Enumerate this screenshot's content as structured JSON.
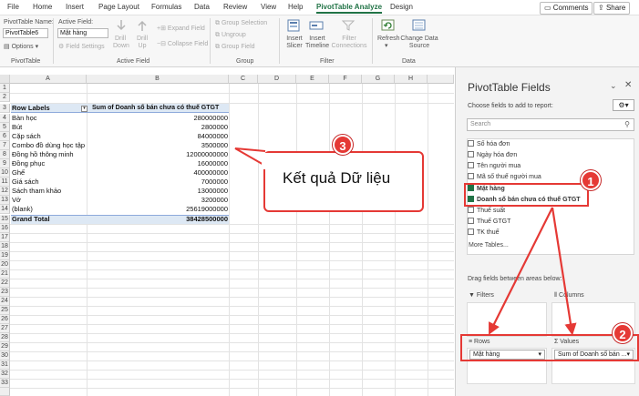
{
  "menu": {
    "items": [
      "File",
      "Home",
      "Insert",
      "Page Layout",
      "Formulas",
      "Data",
      "Review",
      "View",
      "Help",
      "PivotTable Analyze",
      "Design"
    ],
    "comments": "Comments",
    "share": "Share"
  },
  "ribbon": {
    "pt_name_label": "PivotTable Name:",
    "pt_name_value": "PivotTable6",
    "options": "Options",
    "active_field_label": "Active Field:",
    "active_field_value": "Mặt hàng",
    "field_settings": "Field Settings",
    "drill_down": "Drill Down",
    "drill_up": "Drill Up",
    "expand_field": "Expand Field",
    "collapse_field": "Collapse Field",
    "group_selection": "Group Selection",
    "ungroup": "Ungroup",
    "group_field": "Group Field",
    "insert_slicer": "Insert Slicer",
    "insert_timeline": "Insert Timeline",
    "filter_connections": "Filter Connections",
    "refresh": "Refresh",
    "change_data_source": "Change Data Source",
    "groups": [
      "PivotTable",
      "Active Field",
      "Group",
      "Filter",
      "Data"
    ]
  },
  "grid": {
    "columns": [
      "A",
      "B",
      "C",
      "D",
      "E",
      "F",
      "G",
      "H"
    ],
    "header_row": {
      "num": "3",
      "label": "Row Labels",
      "value_label": "Sum of Doanh số bán chưa có thuế GTGT"
    },
    "rows": [
      {
        "num": "4",
        "label": "Bàn học",
        "value": "280000000"
      },
      {
        "num": "5",
        "label": "Bút",
        "value": "2800000"
      },
      {
        "num": "6",
        "label": "Cặp sách",
        "value": "84000000"
      },
      {
        "num": "7",
        "label": "Combo đồ dùng học tập",
        "value": "3500000"
      },
      {
        "num": "8",
        "label": "Đồng hồ thông minh",
        "value": "12000000000"
      },
      {
        "num": "9",
        "label": "Đồng phục",
        "value": "16000000"
      },
      {
        "num": "10",
        "label": "Ghế",
        "value": "400000000"
      },
      {
        "num": "11",
        "label": "Giá sách",
        "value": "7000000"
      },
      {
        "num": "12",
        "label": "Sách tham khảo",
        "value": "13000000"
      },
      {
        "num": "13",
        "label": "Vở",
        "value": "3200000"
      },
      {
        "num": "14",
        "label": "(blank)",
        "value": "25619000000"
      }
    ],
    "total_row": {
      "num": "15",
      "label": "Grand Total",
      "value": "38428500000"
    },
    "empty_rows": [
      "1",
      "2",
      "16",
      "17",
      "18",
      "19",
      "20",
      "21",
      "22",
      "23",
      "24",
      "25",
      "26",
      "27",
      "28",
      "29",
      "30",
      "31",
      "32",
      "33"
    ]
  },
  "callout": {
    "badge": "3",
    "text": "Kết quả Dữ liệu"
  },
  "pane": {
    "title": "PivotTable Fields",
    "choose_label": "Choose fields to add to report:",
    "search_placeholder": "Search",
    "fields": [
      {
        "label": "Số hóa đơn",
        "checked": false
      },
      {
        "label": "Ngày hóa đơn",
        "checked": false
      },
      {
        "label": "Tên người mua",
        "checked": false
      },
      {
        "label": "Mã số thuế người mua",
        "checked": false
      },
      {
        "label": "Mặt hàng",
        "checked": true
      },
      {
        "label": "Doanh số bán chưa có thuế GTGT",
        "checked": true
      },
      {
        "label": "Thuế suất",
        "checked": false
      },
      {
        "label": "Thuế GTGT",
        "checked": false
      },
      {
        "label": "TK thuế",
        "checked": false
      }
    ],
    "more_tables": "More Tables...",
    "drag_label": "Drag fields between areas below:",
    "filters": "Filters",
    "columns": "Columns",
    "rows": "Rows",
    "values": "Values",
    "rows_item": "Mặt hàng",
    "values_item": "Sum of Doanh số bán ...",
    "badge1": "1",
    "badge2": "2"
  },
  "colors": {
    "accent": "#217346",
    "callout": "#e53935",
    "pivot_header": "#dde8f4"
  }
}
